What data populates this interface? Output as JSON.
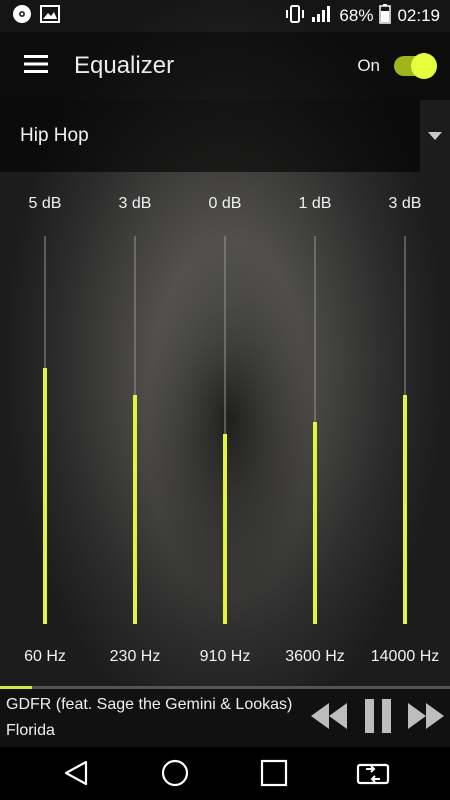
{
  "status": {
    "battery_percent": "68%",
    "time": "02:19"
  },
  "appbar": {
    "title": "Equalizer",
    "toggle_label": "On"
  },
  "preset": {
    "selected": "Hip Hop"
  },
  "bands": [
    {
      "db": "5 dB",
      "hz": "60 Hz",
      "level": 0.66
    },
    {
      "db": "3 dB",
      "hz": "230 Hz",
      "level": 0.59
    },
    {
      "db": "0 dB",
      "hz": "910 Hz",
      "level": 0.49
    },
    {
      "db": "1 dB",
      "hz": "3600 Hz",
      "level": 0.52
    },
    {
      "db": "3 dB",
      "hz": "14000 Hz",
      "level": 0.59
    }
  ],
  "player": {
    "song": "GDFR (feat. Sage the Gemini & Lookas)",
    "artist": "Florida",
    "progress": 0.07
  },
  "colors": {
    "accent": "#e2f53a",
    "switch_track": "#9fb51a"
  }
}
